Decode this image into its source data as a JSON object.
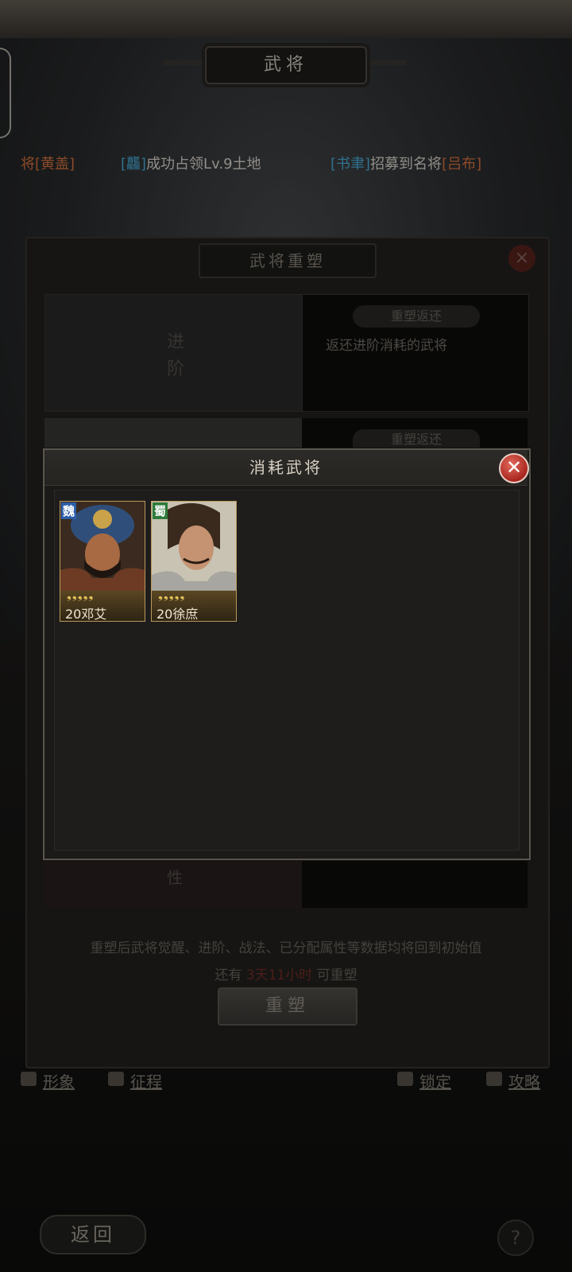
{
  "header": {
    "title": "武将"
  },
  "ticker": [
    {
      "prefix": "将",
      "bracket": "黄盖",
      "tail": ""
    },
    {
      "bracket": "龘",
      "tail": "成功占领Lv.9土地"
    },
    {
      "bracket": "书聿",
      "tail": "招募到名将",
      "bracket2": "吕布"
    }
  ],
  "rebuild_dialog": {
    "title": "武将重塑",
    "row1_left_a": "进",
    "row1_left_b": "阶",
    "row1_tag": "重塑返还",
    "row1_desc": "返还进阶消耗的武将",
    "row2_tag": "重塑返还",
    "row3_left": "性",
    "note": "重塑后武将觉醒、进阶、战法、已分配属性等数据均将回到初始值",
    "time_prefix": "还有",
    "time_value": "3天11小时",
    "time_suffix": "可重塑",
    "button": "重塑"
  },
  "bottom_nav": {
    "left": [
      "形象",
      "征程"
    ],
    "right": [
      "锁定",
      "攻略"
    ]
  },
  "back_label": "返回",
  "help_label": "?",
  "popup": {
    "title": "消耗武将",
    "close_glyph": "✕",
    "cards": [
      {
        "faction": "魏",
        "level": "20",
        "name": "邓艾",
        "stars": 5
      },
      {
        "faction": "蜀",
        "level": "20",
        "name": "徐庶",
        "stars": 5
      }
    ]
  },
  "colors": {
    "accent_orange": "#e07a43",
    "accent_blue": "#4fb6e6",
    "close_red": "#a8261f"
  }
}
